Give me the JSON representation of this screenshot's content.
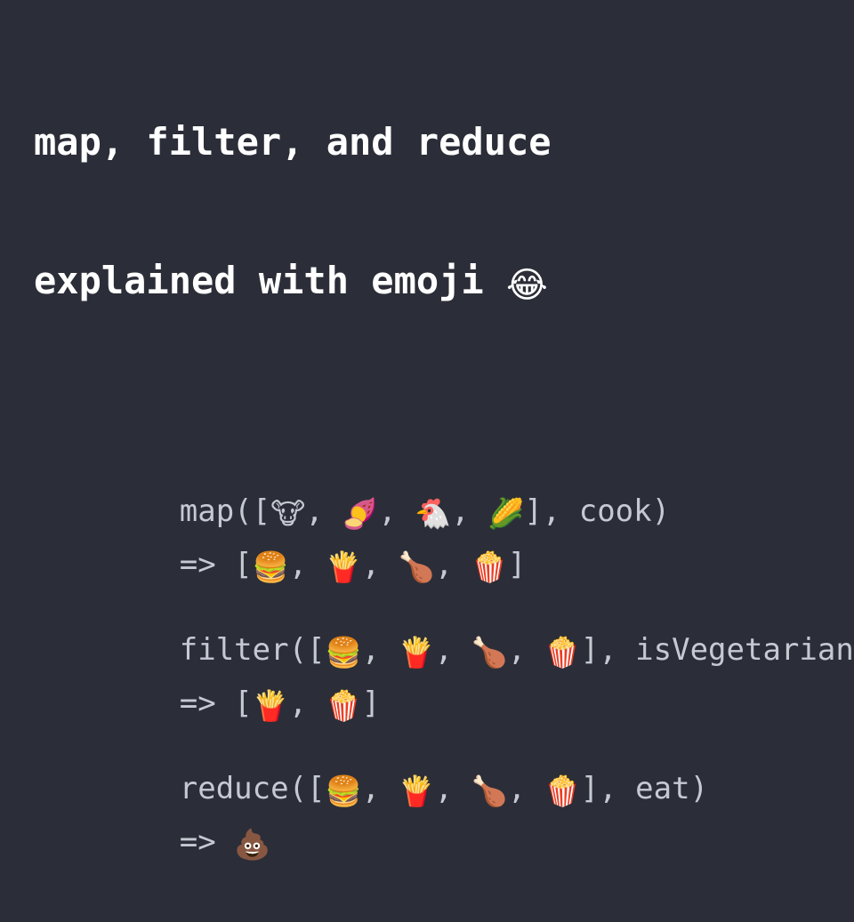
{
  "slide": {
    "background_color": "#2b2e38",
    "title": {
      "line1": "map, filter, and reduce",
      "line2": "explained with emoji ",
      "line2_emoji": "😂",
      "color": "#ffffff"
    },
    "code_color": "#c5cad2",
    "blocks": [
      {
        "name": "map",
        "call": {
          "prefix": "map([",
          "items": [
            "🐮",
            "🍠",
            "🐔",
            "🌽"
          ],
          "separator": ", ",
          "suffix": "], cook)"
        },
        "result": {
          "arrow": "=> [",
          "items": [
            "🍔",
            "🍟",
            "🍗",
            "🍿"
          ],
          "separator": ", ",
          "suffix": "]"
        }
      },
      {
        "name": "filter",
        "call": {
          "prefix": "filter([",
          "items": [
            "🍔",
            "🍟",
            "🍗",
            "🍿"
          ],
          "separator": ", ",
          "suffix": "], isVegetarian)"
        },
        "result": {
          "arrow": "=> [",
          "items": [
            "🍟",
            "🍿"
          ],
          "separator": ", ",
          "suffix": "]"
        }
      },
      {
        "name": "reduce",
        "call": {
          "prefix": "reduce([",
          "items": [
            "🍔",
            "🍟",
            "🍗",
            "🍿"
          ],
          "separator": ", ",
          "suffix": "], eat)"
        },
        "result": {
          "arrow": "=> ",
          "items": [
            "💩"
          ],
          "separator": ", ",
          "suffix": ""
        }
      }
    ]
  }
}
